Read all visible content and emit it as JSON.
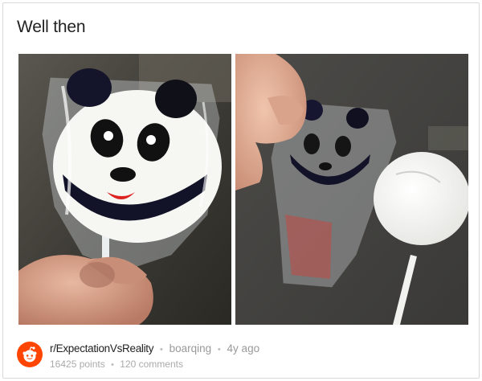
{
  "post": {
    "title": "Well then",
    "subreddit": "r/ExpectationVsReality",
    "author": "boarqing",
    "age": "4y ago",
    "points": "16425 points",
    "comments": "120 comments",
    "separator": "•"
  },
  "images": {
    "left": {
      "subject": "expectation-panda-lollipop"
    },
    "right": {
      "subject": "reality-plain-lollipop"
    }
  },
  "colors": {
    "reddit_orange": "#ff4500",
    "title_text": "#222222",
    "meta_text": "#999999"
  },
  "icons": {
    "community": "reddit-alien-icon"
  }
}
